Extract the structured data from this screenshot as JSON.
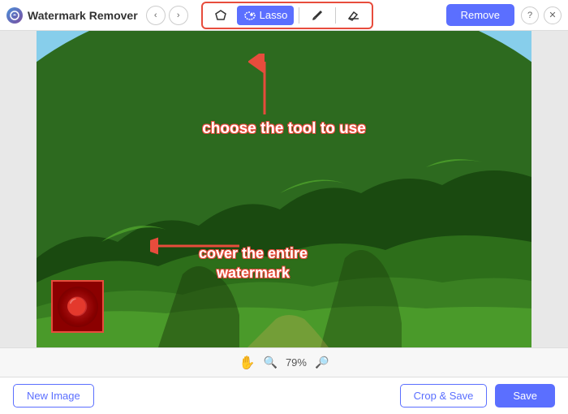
{
  "app": {
    "title": "Watermark Remover",
    "logo_color": "#5b6fff"
  },
  "toolbar": {
    "tools": [
      {
        "id": "polygon",
        "label": "",
        "icon": "polygon"
      },
      {
        "id": "lasso",
        "label": "Lasso",
        "icon": "lasso",
        "active": true
      },
      {
        "id": "brush",
        "label": "",
        "icon": "brush"
      },
      {
        "id": "eraser",
        "label": "",
        "icon": "eraser"
      }
    ],
    "remove_label": "Remove"
  },
  "canvas": {
    "annotation_top": "choose the tool to use",
    "annotation_bottom_line1": "cover the entire",
    "annotation_bottom_line2": "watermark",
    "zoom_level": "79%"
  },
  "actions": {
    "new_image_label": "New Image",
    "crop_save_label": "Crop & Save",
    "save_label": "Save"
  },
  "status": {
    "zoom": "79%"
  }
}
